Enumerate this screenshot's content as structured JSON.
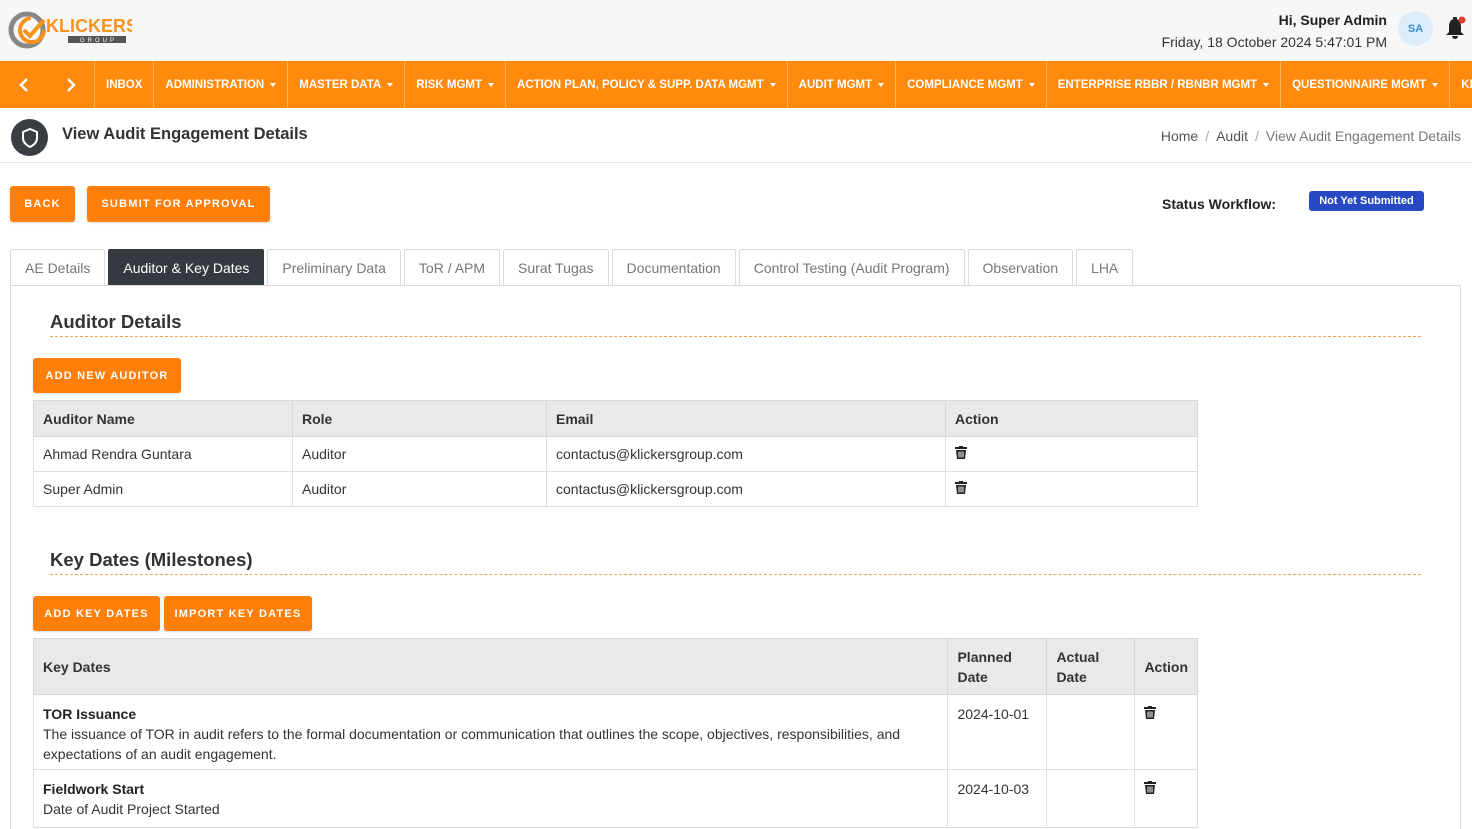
{
  "header": {
    "logo_text": "KLICKERS",
    "logo_sub": "GROUP",
    "greeting": "Hi, Super Admin",
    "datetime": "Friday, 18 October 2024 5:47:01 PM",
    "avatar_initials": "SA"
  },
  "nav": {
    "prev_icon": "chevron-left-icon",
    "next_icon": "chevron-right-icon",
    "items": [
      {
        "label": "INBOX",
        "dropdown": false
      },
      {
        "label": "ADMINISTRATION",
        "dropdown": true
      },
      {
        "label": "MASTER DATA",
        "dropdown": true
      },
      {
        "label": "RISK MGMT",
        "dropdown": true
      },
      {
        "label": "ACTION PLAN, POLICY & SUPP. DATA MGMT",
        "dropdown": true
      },
      {
        "label": "AUDIT MGMT",
        "dropdown": true
      },
      {
        "label": "COMPLIANCE MGMT",
        "dropdown": true
      },
      {
        "label": "ENTERPRISE RBBR / RBNBR MGMT",
        "dropdown": true
      },
      {
        "label": "QUESTIONNAIRE MGMT",
        "dropdown": true
      },
      {
        "label": "KL",
        "dropdown": false
      }
    ]
  },
  "page": {
    "title": "View Audit Engagement Details",
    "breadcrumb": [
      "Home",
      "Audit",
      "View Audit Engagement Details"
    ]
  },
  "actions": {
    "back": "BACK",
    "submit": "SUBMIT FOR APPROVAL",
    "status_label": "Status Workflow:",
    "status_value": "Not Yet Submitted"
  },
  "tabs": [
    {
      "label": "AE Details",
      "active": false
    },
    {
      "label": "Auditor & Key Dates",
      "active": true
    },
    {
      "label": "Preliminary Data",
      "active": false
    },
    {
      "label": "ToR / APM",
      "active": false
    },
    {
      "label": "Surat Tugas",
      "active": false
    },
    {
      "label": "Documentation",
      "active": false
    },
    {
      "label": "Control Testing (Audit Program)",
      "active": false
    },
    {
      "label": "Observation",
      "active": false
    },
    {
      "label": "LHA",
      "active": false
    }
  ],
  "auditors": {
    "title": "Auditor Details",
    "add_button": "ADD NEW AUDITOR",
    "columns": [
      "Auditor Name",
      "Role",
      "Email",
      "Action"
    ],
    "rows": [
      {
        "name": "Ahmad Rendra Guntara",
        "role": "Auditor",
        "email": "contactus@klickersgroup.com"
      },
      {
        "name": "Super Admin",
        "role": "Auditor",
        "email": "contactus@klickersgroup.com"
      }
    ]
  },
  "key_dates": {
    "title": "Key Dates (Milestones)",
    "add_button": "ADD KEY DATES",
    "import_button": "IMPORT KEY DATES",
    "columns": [
      "Key Dates",
      "Planned Date",
      "Actual Date",
      "Action"
    ],
    "rows": [
      {
        "title": "TOR Issuance",
        "description": "The issuance of TOR in audit refers to the formal documentation or communication that outlines the scope, objectives, responsibilities, and expectations of an audit engagement.",
        "planned": "2024-10-01",
        "actual": ""
      },
      {
        "title": "Fieldwork Start",
        "description": "Date of Audit Project Started",
        "planned": "2024-10-03",
        "actual": ""
      }
    ]
  },
  "colors": {
    "accent": "#ff8a0d",
    "button": "#ff7f0a",
    "active_tab": "#343a40",
    "status_badge": "#2749c4"
  }
}
